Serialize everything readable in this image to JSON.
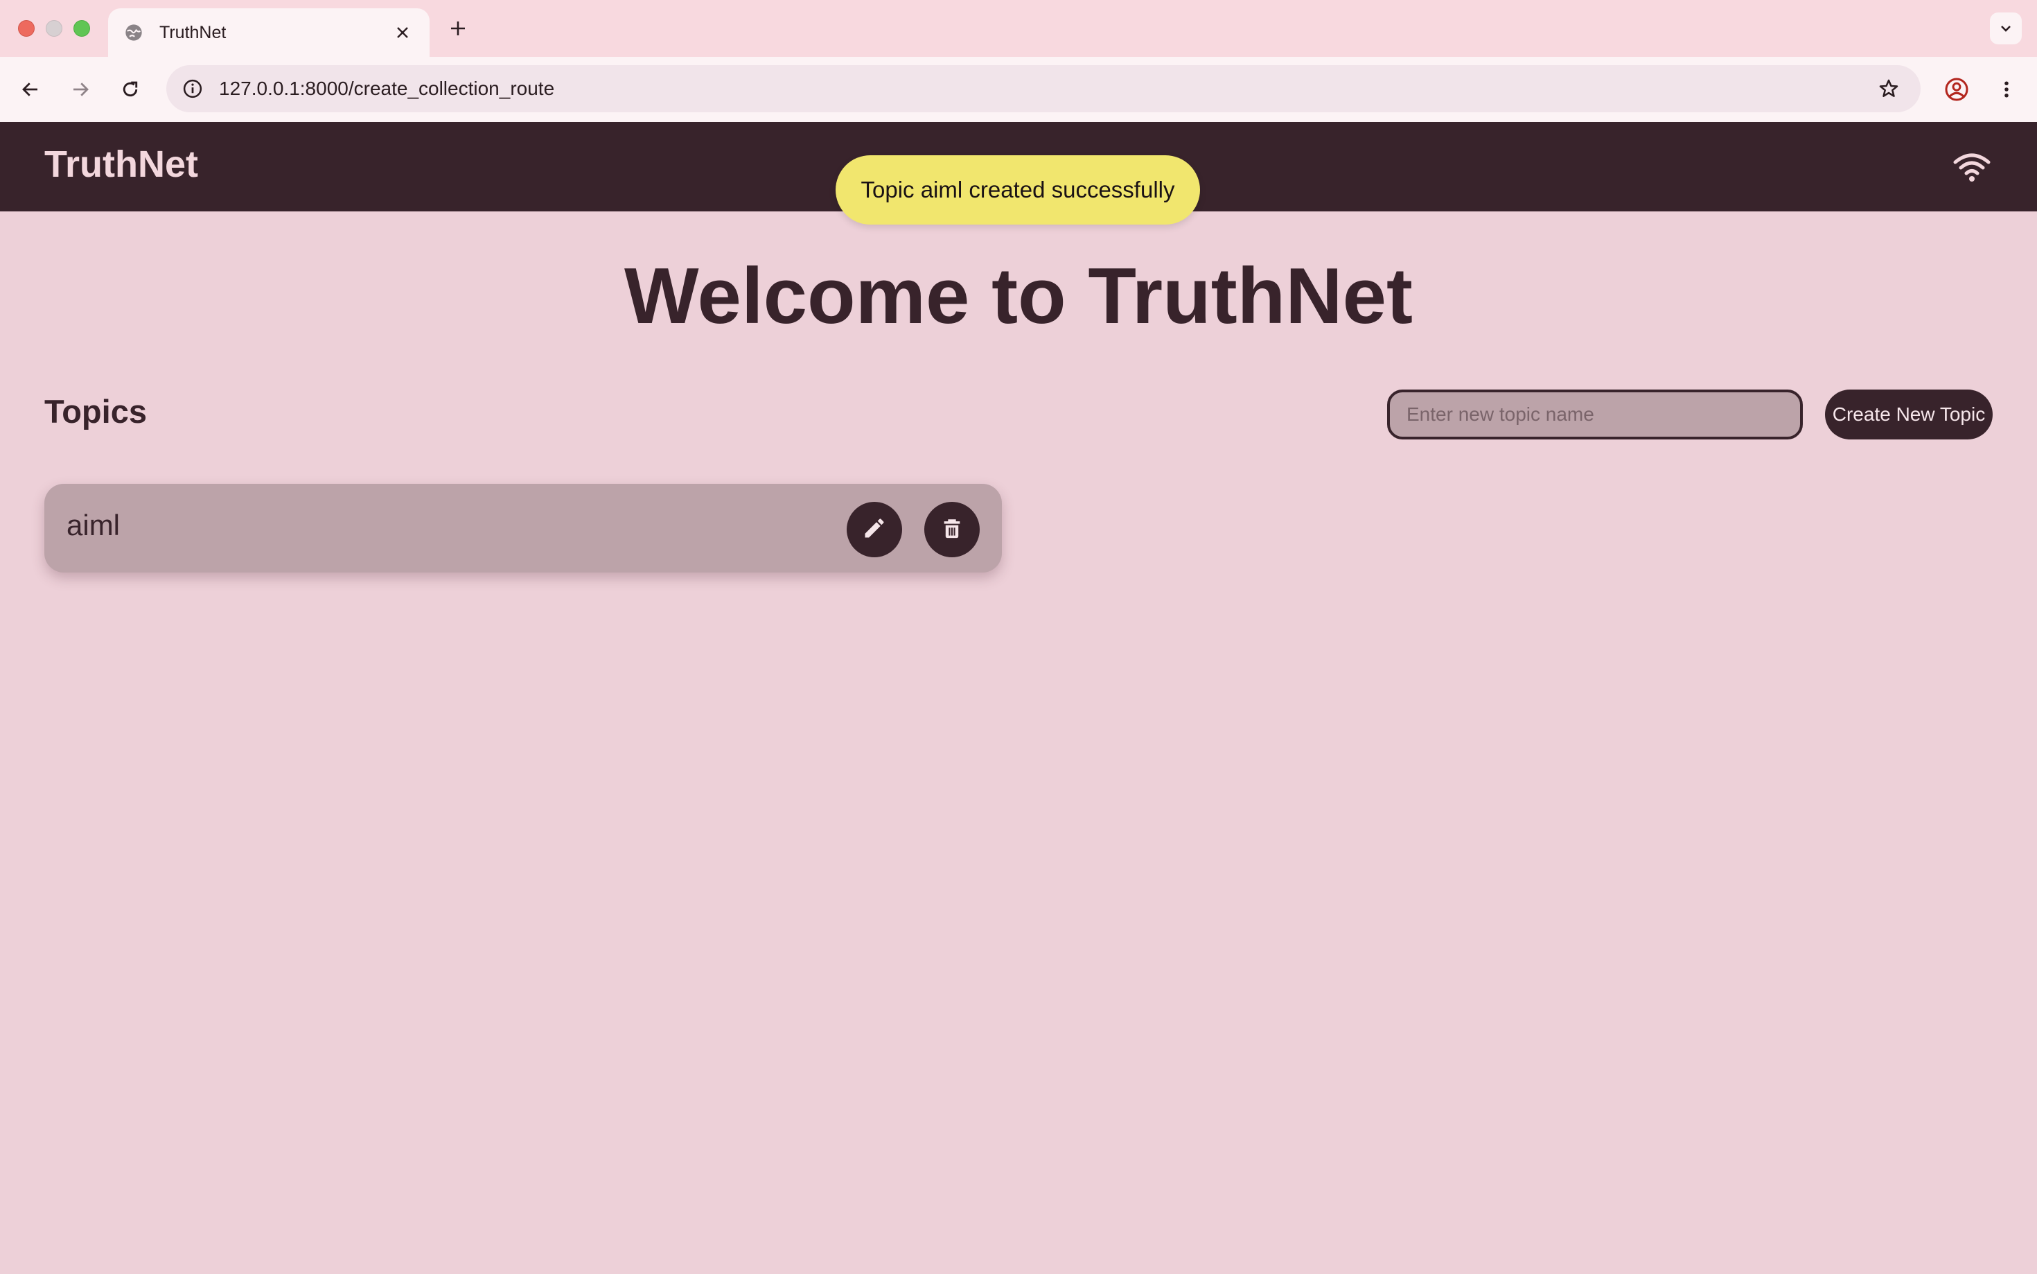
{
  "browser": {
    "tab": {
      "title": "TruthNet"
    },
    "url": "127.0.0.1:8000/create_collection_route"
  },
  "app": {
    "brand": "TruthNet",
    "toast": "Topic aiml created successfully",
    "welcome": "Welcome to TruthNet",
    "topics_heading": "Topics",
    "new_topic": {
      "placeholder": "Enter new topic name",
      "value": ""
    },
    "create_button": "Create New Topic",
    "topics": [
      {
        "name": "aiml"
      }
    ]
  },
  "colors": {
    "appbar": "#38232b",
    "background": "#edd0d8",
    "card": "#bca3a9",
    "toast": "#f1e66e"
  },
  "icons": {
    "edit": "pencil-icon",
    "delete": "trash-icon",
    "connection": "wifi-icon"
  }
}
